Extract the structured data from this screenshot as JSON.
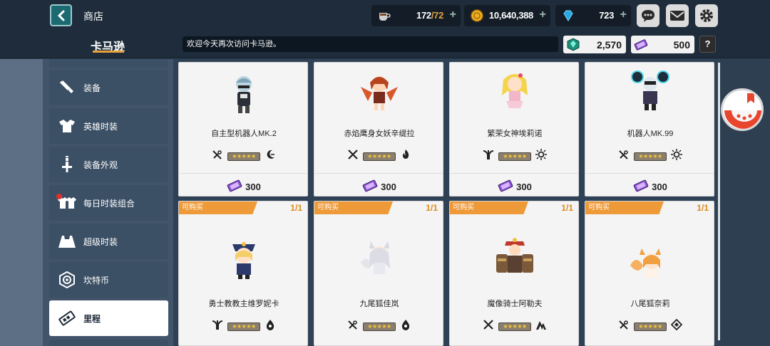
{
  "header": {
    "page_title": "商店",
    "shop_name": "卡马逊",
    "welcome": "欢迎今天再次访问卡马逊。",
    "resources": [
      {
        "icon": "coffee-cup-icon",
        "value_current": "172",
        "value_max": "/72"
      },
      {
        "icon": "gold-coin-icon",
        "value": "10,640,388"
      },
      {
        "icon": "blue-gem-icon",
        "value": "723"
      }
    ],
    "currencies": [
      {
        "icon": "crystal-currency-icon",
        "value": "2,570"
      },
      {
        "icon": "mileage-ticket-icon",
        "value": "500"
      }
    ],
    "help": "?"
  },
  "sidebar": {
    "items": [
      {
        "label": "装备",
        "icon": "equipment-icon"
      },
      {
        "label": "英雄时装",
        "icon": "hero-costume-icon"
      },
      {
        "label": "装备外观",
        "icon": "equipment-appearance-icon"
      },
      {
        "label": "每日时装组合",
        "icon": "daily-costume-set-icon"
      },
      {
        "label": "超级时装",
        "icon": "super-costume-icon"
      },
      {
        "label": "坎特币",
        "icon": "kante-coin-icon"
      },
      {
        "label": "里程",
        "icon": "mileage-icon"
      }
    ]
  },
  "products": [
    {
      "name": "自主型机器人MK.2",
      "price": "300",
      "stars": "★★★★★",
      "left_icon": "no-weapon-icon",
      "right_icon": "moon-icon"
    },
    {
      "name": "赤焰鹰身女妖辛缇拉",
      "price": "300",
      "stars": "★★★★★",
      "left_icon": "crossed-swords-icon",
      "right_icon": "fire-icon"
    },
    {
      "name": "繁荣女神埃莉诺",
      "price": "300",
      "stars": "★★★★★",
      "left_icon": "support-icon",
      "right_icon": "light-icon"
    },
    {
      "name": "机器人MK.99",
      "price": "300",
      "stars": "★★★★★",
      "left_icon": "no-weapon-icon",
      "right_icon": "light-icon"
    },
    {
      "name": "勇士教教主维罗妮卡",
      "banner": "可购买",
      "count_current": "1",
      "count_max": "/1",
      "stars": "★★★★★",
      "left_icon": "support-icon",
      "right_icon": "dark-icon"
    },
    {
      "name": "九尾狐佳岚",
      "banner": "可购买",
      "count_current": "1",
      "count_max": "/1",
      "stars": "★★★★★",
      "left_icon": "no-weapon-icon",
      "right_icon": "dark-icon"
    },
    {
      "name": "魔像骑士阿勒夫",
      "banner": "可购买",
      "count_current": "1",
      "count_max": "/1",
      "stars": "★★★★★",
      "left_icon": "crossed-swords-icon",
      "right_icon": "earth-icon"
    },
    {
      "name": "八尾狐奈莉",
      "banner": "可购买",
      "count_current": "1",
      "count_max": "/1",
      "stars": "★★★★★",
      "left_icon": "no-weapon-icon",
      "right_icon": "basic-icon"
    }
  ],
  "colors": {
    "accent": "#ef9a38",
    "active_tab": "#ffffff",
    "background": "#2e3f52"
  }
}
